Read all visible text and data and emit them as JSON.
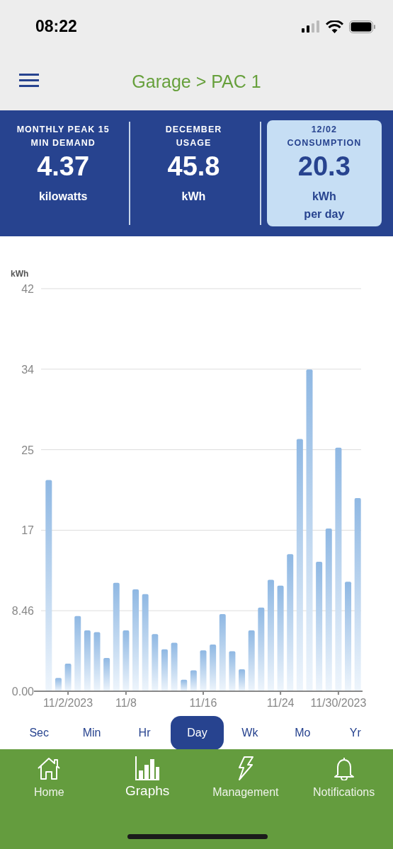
{
  "status_bar": {
    "time": "08:22"
  },
  "header": {
    "title": "Garage > PAC 1"
  },
  "stats": [
    {
      "label": "MONTHLY PEAK 15\nMIN DEMAND",
      "value": "4.37",
      "unit": "kilowatts",
      "selected": false
    },
    {
      "label": "DECEMBER\nUSAGE",
      "value": "45.8",
      "unit": "kWh",
      "selected": false
    },
    {
      "label": "12/02\nCONSUMPTION",
      "value": "20.3",
      "unit": "kWh\nper day",
      "selected": true
    }
  ],
  "chart_data": {
    "type": "bar",
    "ylabel": "kWh",
    "categories": [
      null,
      null,
      "11/2/2023",
      null,
      null,
      null,
      null,
      null,
      "11/8",
      null,
      null,
      null,
      null,
      null,
      null,
      null,
      "11/16",
      null,
      null,
      null,
      null,
      null,
      null,
      null,
      "11/24",
      null,
      null,
      null,
      null,
      null,
      "11/30/2023",
      null,
      null
    ],
    "grid": true,
    "series": [
      {
        "color": "#8fb8e3",
        "values": [
          22.2,
          1.4,
          2.9,
          7.9,
          6.4,
          6.2,
          3.5,
          11.4,
          6.4,
          10.7,
          10.2,
          6.0,
          4.4,
          5.1,
          1.2,
          2.2,
          4.3,
          4.9,
          8.1,
          4.2,
          2.3,
          6.4,
          8.8,
          11.7,
          11.1,
          14.4,
          26.5,
          33.8,
          13.6,
          17.1,
          25.6,
          11.5,
          20.3
        ]
      }
    ],
    "ylim": [
      0,
      42.3
    ],
    "yticks": [
      {
        "value": 0,
        "label": "0.00"
      },
      {
        "value": 8.46,
        "label": "8.46"
      },
      {
        "value": 16.92,
        "label": "17"
      },
      {
        "value": 25.38,
        "label": "25"
      },
      {
        "value": 33.84,
        "label": "34"
      },
      {
        "value": 42.3,
        "label": "42"
      }
    ]
  },
  "ranges": [
    {
      "label": "Sec",
      "selected": false
    },
    {
      "label": "Min",
      "selected": false
    },
    {
      "label": "Hr",
      "selected": false
    },
    {
      "label": "Day",
      "selected": true
    },
    {
      "label": "Wk",
      "selected": false
    },
    {
      "label": "Mo",
      "selected": false
    },
    {
      "label": "Yr",
      "selected": false
    }
  ],
  "nav": [
    {
      "label": "Home",
      "kind": "home",
      "selected": false
    },
    {
      "label": "Graphs",
      "kind": "graphs",
      "selected": true
    },
    {
      "label": "Management",
      "kind": "management",
      "selected": false
    },
    {
      "label": "Notifications",
      "kind": "notifications",
      "selected": false
    }
  ]
}
